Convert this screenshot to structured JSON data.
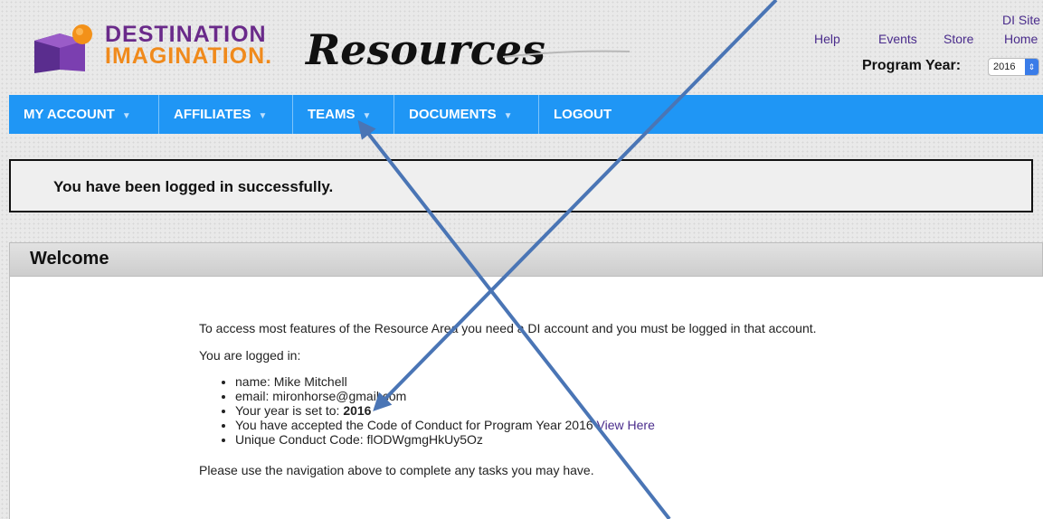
{
  "logo": {
    "line1": "DESTINATION",
    "line2": "IMAGINATION.",
    "title": "Resources"
  },
  "toplinks": {
    "di_site": "DI Site",
    "help": "Help",
    "events": "Events",
    "store": "Store",
    "home": "Home"
  },
  "program_year": {
    "label": "Program Year:",
    "value": "2016"
  },
  "nav": {
    "items": [
      {
        "label": "MY ACCOUNT",
        "caret": "▼"
      },
      {
        "label": "AFFILIATES",
        "caret": "▼"
      },
      {
        "label": "TEAMS",
        "caret": "▼"
      },
      {
        "label": "DOCUMENTS",
        "caret": "▼"
      },
      {
        "label": "LOGOUT"
      }
    ]
  },
  "message": "You have been logged in successfully.",
  "welcome": {
    "title": "Welcome",
    "intro": "To access most features of the Resource Area you need a DI account and you must be logged in that account.",
    "logged_in": "You are logged in:",
    "details": {
      "name": "name: Mike Mitchell",
      "email": "email: mironhorse@gmail.com",
      "year_prefix": "Your year is set to: ",
      "year_value": "2016",
      "coc_text": "You have accepted the Code of Conduct for Program Year 2016 ",
      "coc_link": "View Here",
      "conduct_code": "Unique Conduct Code: flODWgmgHkUy5Oz"
    },
    "footer": "Please use the navigation above to complete any tasks you may have."
  },
  "colors": {
    "nav_blue": "#1f96f5",
    "link_purple": "#4a2c8c",
    "annotation_arrow": "#4a75b5"
  }
}
